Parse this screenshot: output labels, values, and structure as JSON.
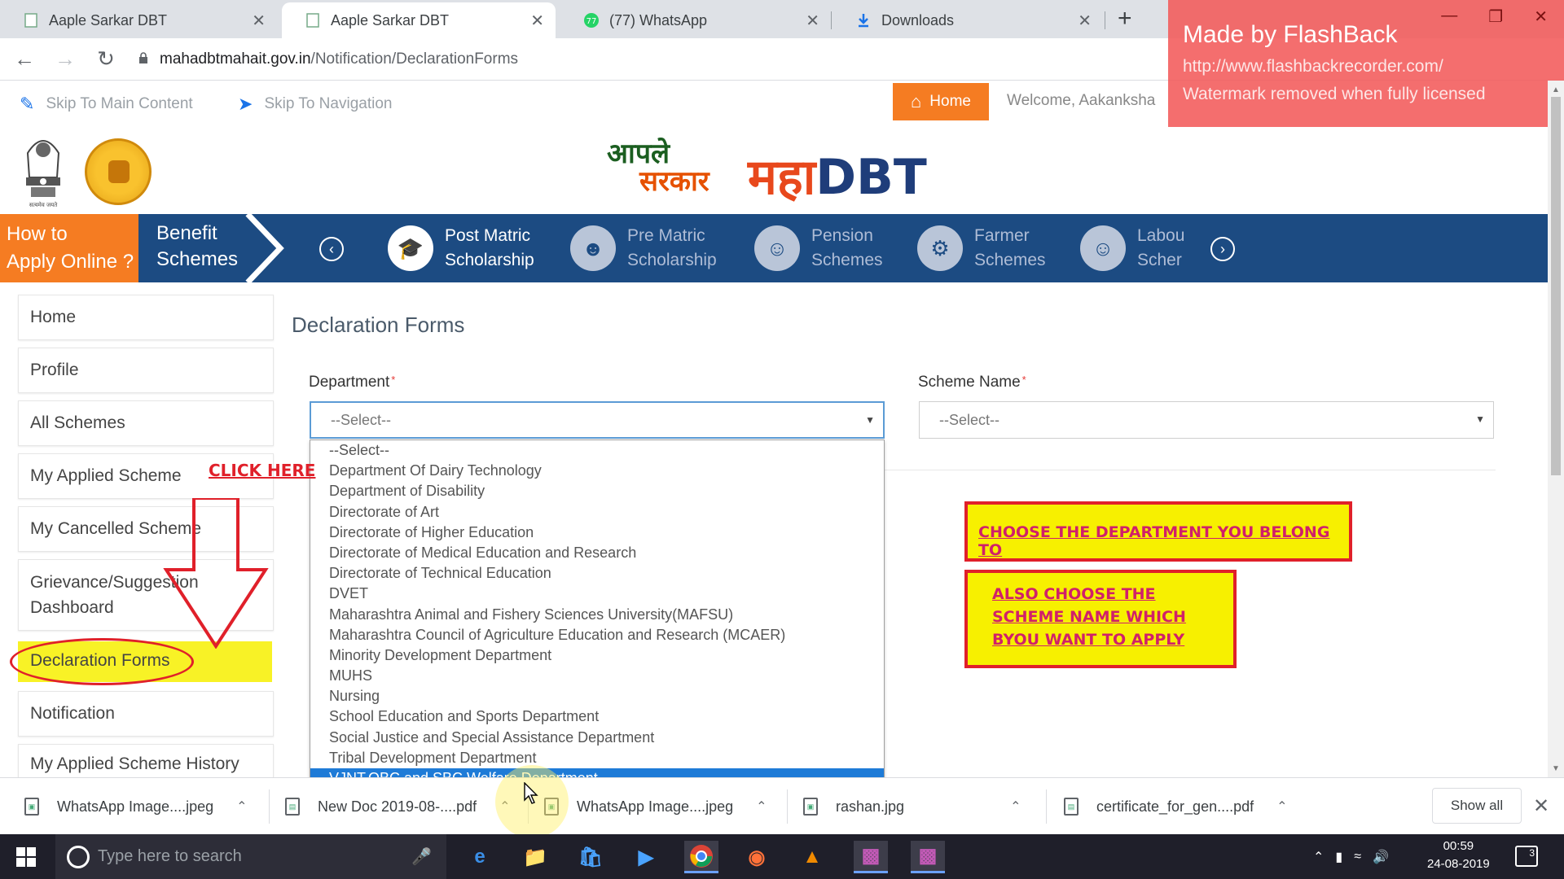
{
  "browser": {
    "tabs": [
      {
        "title": "Aaple Sarkar DBT",
        "active": false,
        "icon": "page-icon"
      },
      {
        "title": "Aaple Sarkar DBT",
        "active": true,
        "icon": "page-icon"
      },
      {
        "title": "(77) WhatsApp",
        "active": false,
        "icon": "whatsapp-icon"
      },
      {
        "title": "Downloads",
        "active": false,
        "icon": "download-icon"
      }
    ],
    "new_tab": "+",
    "close_glyph": "✕",
    "url_host": "mahadbtmahait.gov.in",
    "url_path": "/Notification/DeclarationForms"
  },
  "watermark": {
    "title": "Made by FlashBack",
    "url": "http://www.flashbackrecorder.com/",
    "note": "Watermark removed when fully licensed"
  },
  "site": {
    "skip_main": "Skip To Main Content",
    "skip_nav": "Skip To Navigation",
    "home": "Home",
    "welcome": "Welcome, Aakanksha"
  },
  "header": {
    "aaple_line1": "आपले",
    "aaple_line2": "सरकार",
    "maha": "महा",
    "dbt": "DBT",
    "emblem_caption": "सत्यमेव जयते"
  },
  "nav": {
    "howto_line1": "How to",
    "howto_line2": "Apply Online ?",
    "benefit_line1": "Benefit",
    "benefit_line2": "Schemes",
    "items": [
      {
        "line1": "Post Matric",
        "line2": "Scholarship"
      },
      {
        "line1": "Pre Matric",
        "line2": "Scholarship"
      },
      {
        "line1": "Pension",
        "line2": "Schemes"
      },
      {
        "line1": "Farmer",
        "line2": "Schemes"
      },
      {
        "line1": "Labou",
        "line2": "Scher"
      }
    ]
  },
  "sidebar": {
    "items": [
      {
        "label": "Home"
      },
      {
        "label": "Profile"
      },
      {
        "label": "All Schemes"
      },
      {
        "label": "My Applied Scheme"
      },
      {
        "label": "My Cancelled Scheme"
      },
      {
        "label": "Grievance/Suggestion Dashboard"
      },
      {
        "label": "Declaration Forms"
      },
      {
        "label": "Notification"
      },
      {
        "label": "My Applied Scheme History"
      }
    ]
  },
  "main": {
    "title": "Declaration Forms",
    "department_label": "Department",
    "scheme_label": "Scheme Name",
    "required_mark": "*",
    "department_value": "--Select--",
    "scheme_value": "--Select--",
    "department_options": [
      "--Select--",
      "Department Of Dairy Technology",
      "Department of Disability",
      "Directorate of Art",
      "Directorate of Higher Education",
      "Directorate of Medical Education and Research",
      "Directorate of Technical Education",
      "DVET",
      "Maharashtra Animal and Fishery Sciences University(MAFSU)",
      "Maharashtra Council of Agriculture Education and Research (MCAER)",
      "Minority Development Department",
      "MUHS",
      "Nursing",
      "School Education and Sports Department",
      "Social Justice and Special Assistance Department",
      "Tribal Development Department",
      "VJNT,OBC and SBC Welfare Department"
    ],
    "highlighted_option_index": 16
  },
  "annotations": {
    "click_here": "CLICK HERE",
    "callout1": "CHOOSE THE DEPARTMENT YOU BELONG TO",
    "callout2_line1": "ALSO CHOOSE THE",
    "callout2_line2": "SCHEME NAME WHICH",
    "callout2_line3": "BYOU WANT TO APPLY"
  },
  "downloads": {
    "items": [
      {
        "name": "WhatsApp Image....jpeg"
      },
      {
        "name": "New Doc 2019-08-....pdf"
      },
      {
        "name": "WhatsApp Image....jpeg"
      },
      {
        "name": "rashan.jpg"
      },
      {
        "name": "certificate_for_gen....pdf"
      }
    ],
    "show_all": "Show all"
  },
  "taskbar": {
    "search_placeholder": "Type here to search",
    "time": "00:59",
    "date": "24-08-2019",
    "notifications": "3"
  },
  "colors": {
    "nav_blue": "#1c4b82",
    "accent_orange": "#f57c22",
    "annotation_red": "#e0202a",
    "annotation_yellow": "#f7f000",
    "select_highlight": "#1e7bd7"
  }
}
